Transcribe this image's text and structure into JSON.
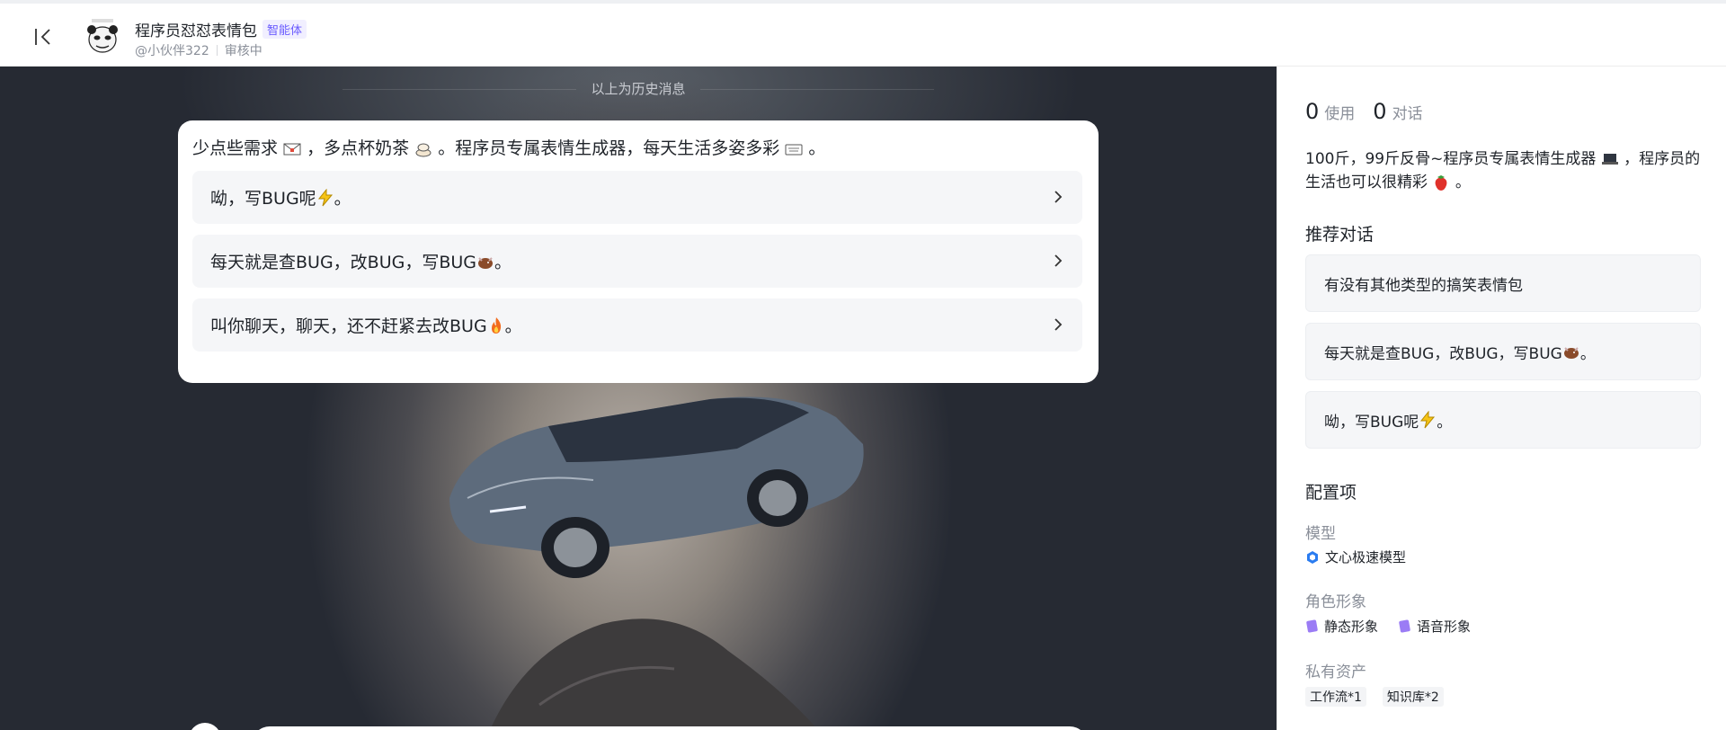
{
  "header": {
    "title": "程序员怼怼表情包",
    "badge": "智能体",
    "author": "@小伙伴322",
    "status": "审核中"
  },
  "chat": {
    "history_divider": "以上为历史消息",
    "welcome": {
      "part1": "少点些需求",
      "part2": "，多点杯奶茶",
      "part3": "。程序员专属表情生成器，每天生活多姿多彩",
      "part4": "。"
    },
    "suggestions": [
      {
        "text": "呦，写BUG呢",
        "tail": "。",
        "emoji": "lightning-emoji"
      },
      {
        "text": "每天就是查BUG，改BUG，写BUG",
        "tail": "。",
        "emoji": "bull-emoji"
      },
      {
        "text": "叫你聊天，聊天，还不赶紧去改BUG",
        "tail": "。",
        "emoji": "fire-emoji"
      }
    ]
  },
  "panel": {
    "uses_count": "0",
    "uses_label": "使用",
    "chats_count": "0",
    "chats_label": "对话",
    "description_part1": "100斤，99斤反骨~程序员专属表情生成器",
    "description_part2": "，程序员的生活也可以很精彩",
    "description_part3": "。",
    "recommend_title": "推荐对话",
    "recommendations": [
      {
        "text": "有没有其他类型的搞笑表情包",
        "tail": ""
      },
      {
        "text": "每天就是查BUG，改BUG，写BUG",
        "tail": "。"
      },
      {
        "text": "呦，写BUG呢",
        "tail": "。"
      }
    ],
    "config_title": "配置项",
    "model_label": "模型",
    "model_value": "文心极速模型",
    "persona_label": "角色形象",
    "persona_static": "静态形象",
    "persona_voice": "语音形象",
    "assets_label": "私有资产",
    "asset_workflow": "工作流*1",
    "asset_knowledge": "知识库*2"
  },
  "colors": {
    "accent": "#6b5cff",
    "chat_bg": "#262a33",
    "card_bg": "#ffffff",
    "suggest_bg": "#f5f6f8"
  }
}
